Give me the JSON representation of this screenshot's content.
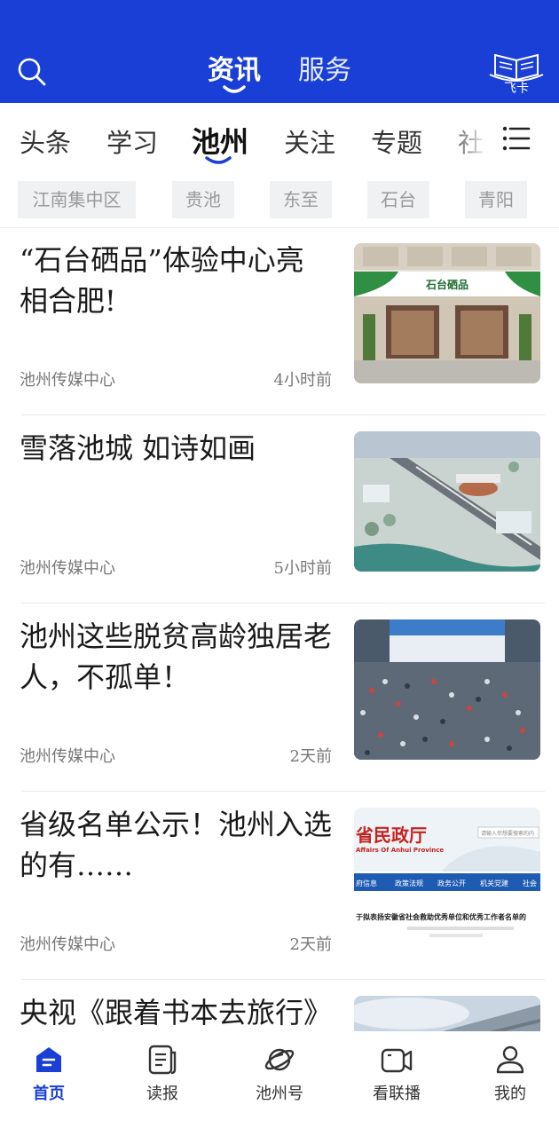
{
  "header": {
    "search_icon": "search-icon",
    "tabs": [
      {
        "label": "资讯",
        "active": true
      },
      {
        "label": "服务",
        "active": false
      }
    ],
    "logo_text": "飞卡",
    "accent_color": "#1a3fd6"
  },
  "channels": {
    "items": [
      "头条",
      "学习",
      "池州",
      "关注",
      "专题",
      "社"
    ],
    "active": "池州",
    "menu_icon": "list-icon"
  },
  "chips": [
    "江南集中区",
    "贵池",
    "东至",
    "石台",
    "青阳"
  ],
  "news": [
    {
      "title": "“石台硒品”体验中心亮相合肥!",
      "source": "池州传媒中心",
      "time": "4小时前",
      "image": "storefront-photo",
      "sign_text": "石台硒品"
    },
    {
      "title": "雪落池城 如诗如画",
      "source": "池州传媒中心",
      "time": "5小时前",
      "image": "aerial-city-photo"
    },
    {
      "title": "池州这些脱贫高龄独居老人，不孤单！",
      "source": "池州传媒中心",
      "time": "2天前",
      "image": "crowd-photo"
    },
    {
      "title": "省级名单公示！池州入选的有……",
      "source": "池州传媒中心",
      "time": "2天前",
      "image": "webpage-screenshot",
      "thumb": {
        "heading": "省民政厅",
        "sub": "Affairs Of Anhui Province",
        "nav": [
          "府信息",
          "政策法规",
          "政务公开",
          "机关党建",
          "社会"
        ],
        "caption": "于拟表扬安徽省社会救助优秀单位和优秀工作者名单的",
        "search_placeholder": "请输入你想要搜索的内"
      }
    },
    {
      "title": "央视《跟着书本去旅行》",
      "source": "",
      "time": "",
      "image": "sky-photo"
    }
  ],
  "tabbar": [
    {
      "label": "首页",
      "icon": "home-icon",
      "active": true
    },
    {
      "label": "读报",
      "icon": "newspaper-icon",
      "active": false
    },
    {
      "label": "池州号",
      "icon": "planet-icon",
      "active": false
    },
    {
      "label": "看联播",
      "icon": "video-camera-icon",
      "active": false
    },
    {
      "label": "我的",
      "icon": "user-icon",
      "active": false
    }
  ]
}
